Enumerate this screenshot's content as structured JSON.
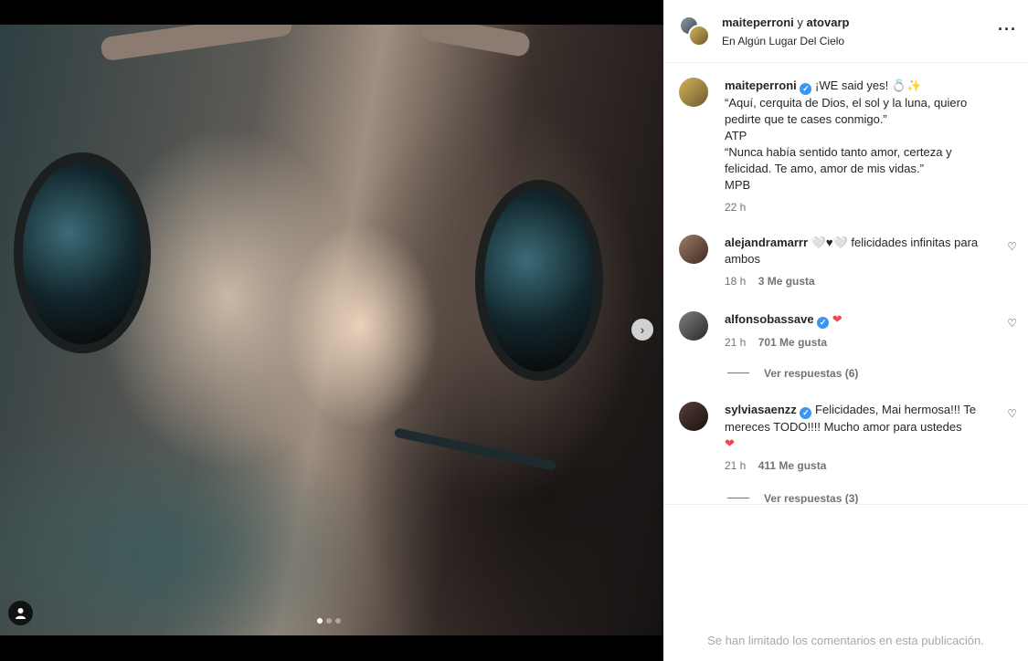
{
  "post": {
    "authors": "maiteperroni",
    "coauthor_conj": "y",
    "coauthor": "atovarp",
    "location": "En Algún Lugar Del Cielo",
    "more_icon": "more-horizontal-icon"
  },
  "caption": {
    "username": "maiteperroni",
    "lines": [
      "¡WE said yes! 💍✨",
      "“Aquí, cerquita de Dios, el sol y la luna, quiero pedirte que te cases conmigo.”",
      "ATP",
      "“Nunca había sentido tanto amor, certeza y felicidad. Te amo, amor de mis vidas.”",
      "MPB"
    ],
    "time": "22 h"
  },
  "comments": [
    {
      "username": "alejandramarrr",
      "text": "🤍♥🤍 felicidades infinitas para ambos",
      "time": "18 h",
      "likes": "3 Me gusta",
      "verified": false
    },
    {
      "username": "alfonsobassave",
      "text": "❤",
      "time": "21 h",
      "likes": "701 Me gusta",
      "verified": true,
      "replies": "Ver respuestas (6)"
    },
    {
      "username": "sylviasaenzz",
      "text": "Felicidades, Mai hermosa!!! Te mereces TODO!!!! Mucho amor para ustedes",
      "text2": "❤",
      "time": "21 h",
      "likes": "411 Me gusta",
      "verified": true,
      "replies": "Ver respuestas (3)"
    }
  ],
  "footer": {
    "note": "Se han limitado los comentarios en esta publicación."
  },
  "carousel": {
    "current": 1,
    "total": 3
  },
  "colors": {
    "verified": "#3897f0",
    "heart": "#ed4956",
    "muted": "#737373"
  }
}
